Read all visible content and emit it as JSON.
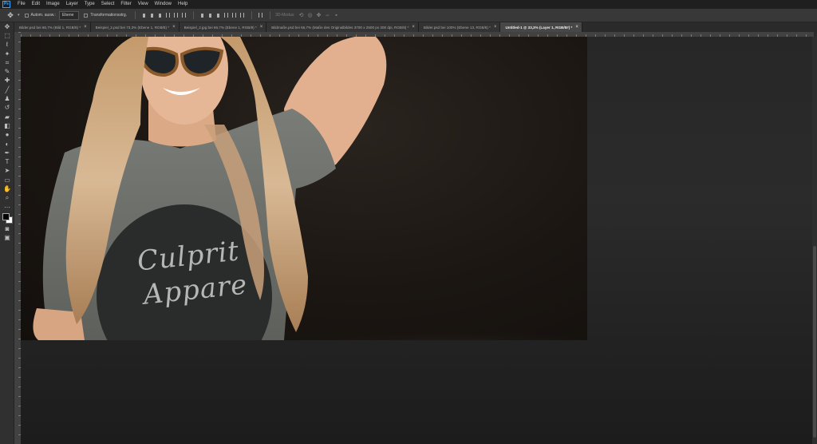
{
  "app": {
    "logo_text": "Ps"
  },
  "menu": [
    "File",
    "Edit",
    "Image",
    "Layer",
    "Type",
    "Select",
    "Filter",
    "View",
    "Window",
    "Help"
  ],
  "options_bar": {
    "tool_icon": "move-icon",
    "auto_select_label": "Autom. ausw.:",
    "auto_select_value": "Ebene",
    "transform_controls_label": "Transformationsstrg.",
    "mode_3d_label": "3D-Modus:"
  },
  "tabs": [
    {
      "label": "Bilder.psd bei 66,7% (Bild 1, RGB/8) *",
      "active": false
    },
    {
      "label": "Beispiel_2.psd bei 73,3% (Ebene 1, RGB/8) *",
      "active": false
    },
    {
      "label": "Beispiel_2.jpg bei 66,7% (Ebene 1, RGB/8) *",
      "active": false
    },
    {
      "label": "Bildmaße.psd bei 66,7% (Maße des Originalbildes 3700 x 2500 px 300 dpi, RGB/8) *",
      "active": false
    },
    {
      "label": "Bilder.psd bei 100% (Ebene 13, RGB/8) *",
      "active": false
    },
    {
      "label": "Untitled-1 @ 33,3% (Layer 1, RGB/8#) *",
      "active": true
    }
  ],
  "tools": [
    "move-icon",
    "marquee-icon",
    "lasso-icon",
    "magic-wand-icon",
    "crop-icon",
    "eyedropper-icon",
    "healing-brush-icon",
    "brush-icon",
    "clone-stamp-icon",
    "history-brush-icon",
    "eraser-icon",
    "gradient-icon",
    "blur-icon",
    "dodge-icon",
    "pen-icon",
    "type-icon",
    "path-selection-icon",
    "rectangle-icon",
    "hand-icon",
    "zoom-icon",
    "more-tools-icon"
  ],
  "canvas": {
    "shirt_text_line1": "Culprit",
    "shirt_text_line2": "Appare"
  },
  "colors": {
    "foreground": "#000000",
    "background": "#ffffff",
    "ui_dark": "#2b2b2b"
  }
}
